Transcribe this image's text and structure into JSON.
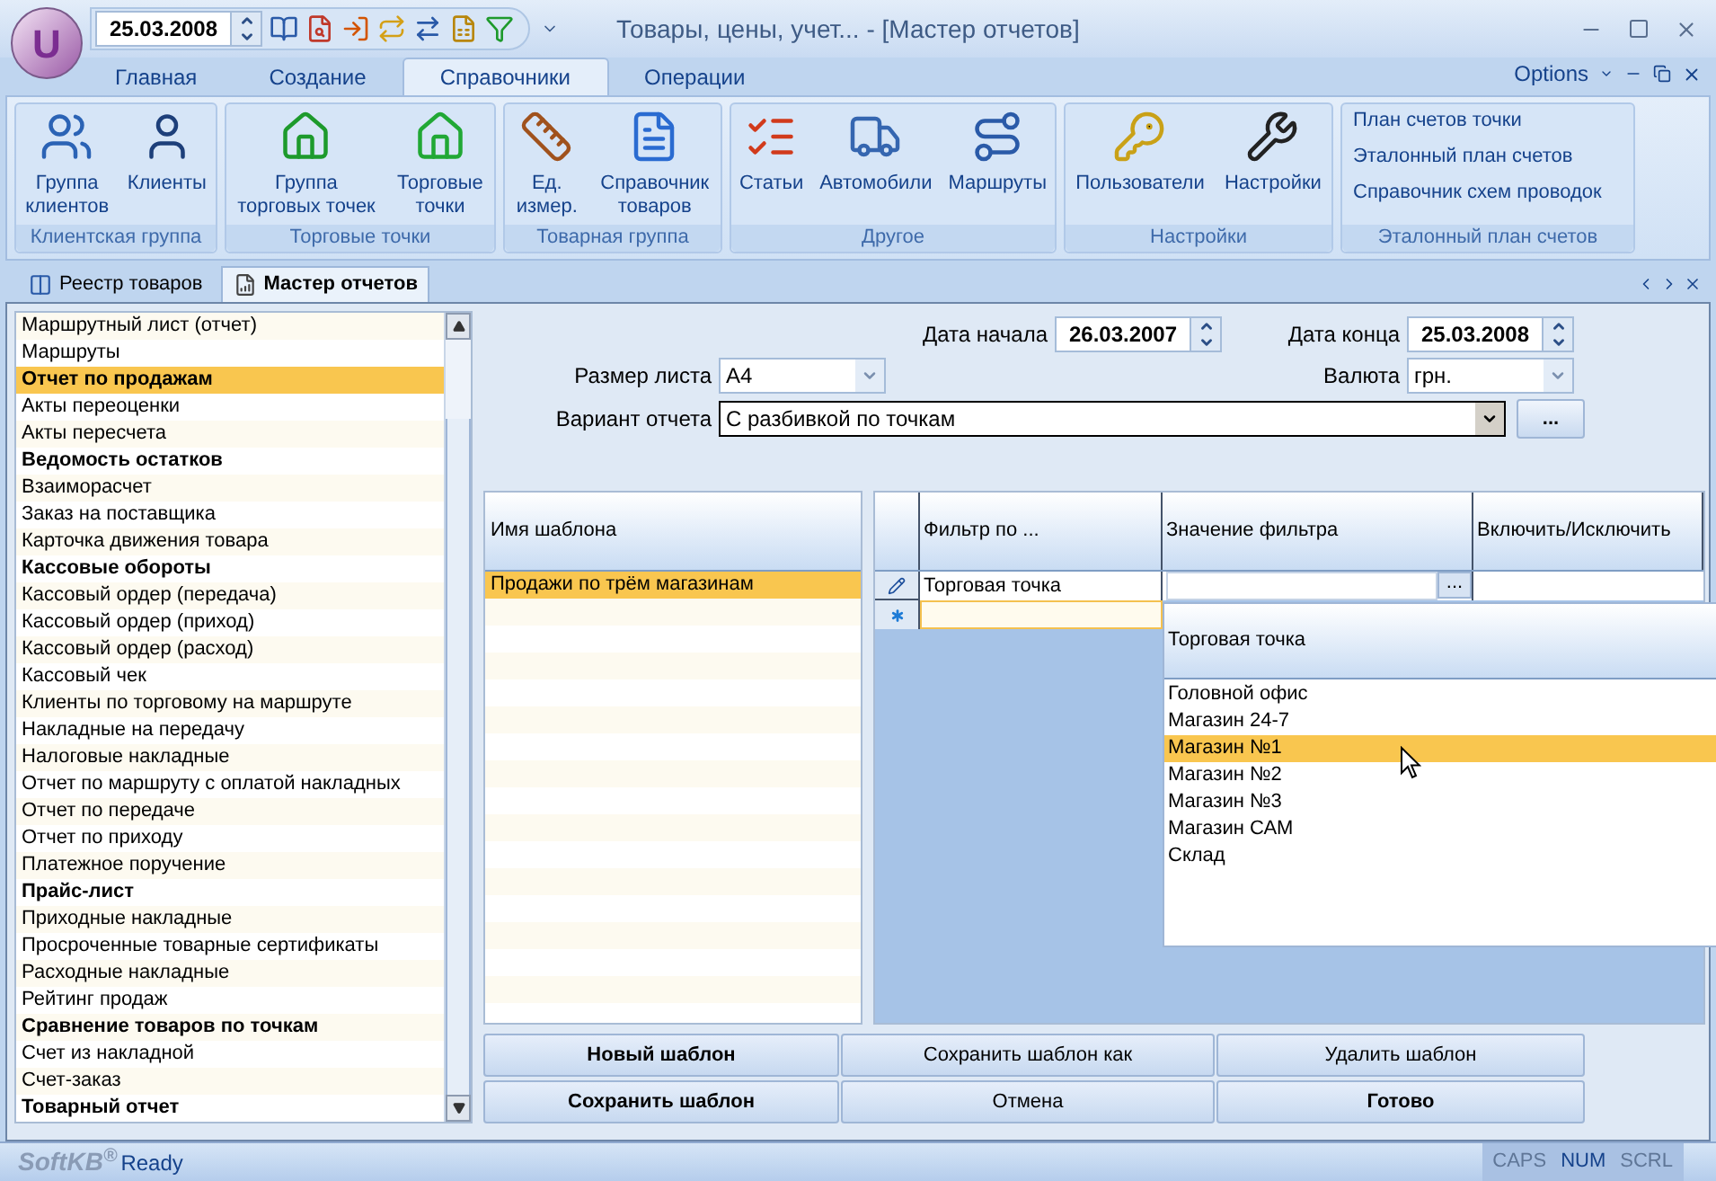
{
  "window": {
    "title": "Товары, цены, учет... - [Мастер отчетов]",
    "app_logo": "U"
  },
  "quick_access": {
    "date": "25.03.2008"
  },
  "ribbon_tabs": [
    {
      "label": "Главная",
      "selected": false
    },
    {
      "label": "Создание",
      "selected": false
    },
    {
      "label": "Справочники",
      "selected": true
    },
    {
      "label": "Операции",
      "selected": false
    }
  ],
  "ribbon_options": "Options",
  "ribbon_groups": [
    {
      "label": "Клиентская группа",
      "kind": "large",
      "buttons": [
        {
          "label": "Группа\nклиентов"
        },
        {
          "label": "Клиенты"
        }
      ]
    },
    {
      "label": "Торговые точки",
      "kind": "large",
      "buttons": [
        {
          "label": "Группа\nторговых точек"
        },
        {
          "label": "Торговые\nточки"
        }
      ]
    },
    {
      "label": "Товарная группа",
      "kind": "large",
      "buttons": [
        {
          "label": "Ед.\nизмер."
        },
        {
          "label": "Справочник\nтоваров"
        }
      ]
    },
    {
      "label": "Другое",
      "kind": "large",
      "buttons": [
        {
          "label": "Статьи"
        },
        {
          "label": "Автомобили"
        },
        {
          "label": "Маршруты"
        }
      ]
    },
    {
      "label": "Настройки",
      "kind": "large",
      "buttons": [
        {
          "label": "Пользователи"
        },
        {
          "label": "Настройки"
        }
      ]
    },
    {
      "label": "Эталонный план счетов",
      "kind": "small",
      "buttons": [
        {
          "label": "План счетов точки"
        },
        {
          "label": "Эталонный план счетов"
        },
        {
          "label": "Справочник схем проводок"
        }
      ]
    }
  ],
  "doc_tabs": [
    {
      "label": "Реестр товаров",
      "selected": false
    },
    {
      "label": "Мастер отчетов",
      "selected": true
    }
  ],
  "report_list": [
    {
      "label": "Маршрутный лист (отчет)",
      "bold": false,
      "selected": false
    },
    {
      "label": "Маршруты",
      "bold": false,
      "selected": false
    },
    {
      "label": "Отчет по продажам",
      "bold": true,
      "selected": true
    },
    {
      "label": "Акты переоценки",
      "bold": false,
      "selected": false
    },
    {
      "label": "Акты пересчета",
      "bold": false,
      "selected": false
    },
    {
      "label": "Ведомость остатков",
      "bold": true,
      "selected": false
    },
    {
      "label": "Взаиморасчет",
      "bold": false,
      "selected": false
    },
    {
      "label": "Заказ на поставщика",
      "bold": false,
      "selected": false
    },
    {
      "label": "Карточка движения товара",
      "bold": false,
      "selected": false
    },
    {
      "label": "Кассовые обороты",
      "bold": true,
      "selected": false
    },
    {
      "label": "Кассовый ордер (передача)",
      "bold": false,
      "selected": false
    },
    {
      "label": "Кассовый ордер (приход)",
      "bold": false,
      "selected": false
    },
    {
      "label": "Кассовый ордер (расход)",
      "bold": false,
      "selected": false
    },
    {
      "label": "Кассовый чек",
      "bold": false,
      "selected": false
    },
    {
      "label": "Клиенты по торговому на маршруте",
      "bold": false,
      "selected": false
    },
    {
      "label": "Накладные на передачу",
      "bold": false,
      "selected": false
    },
    {
      "label": "Налоговые накладные",
      "bold": false,
      "selected": false
    },
    {
      "label": "Отчет по маршруту с оплатой накладных",
      "bold": false,
      "selected": false
    },
    {
      "label": "Отчет по передаче",
      "bold": false,
      "selected": false
    },
    {
      "label": "Отчет по приходу",
      "bold": false,
      "selected": false
    },
    {
      "label": "Платежное поручение",
      "bold": false,
      "selected": false
    },
    {
      "label": "Прайс-лист",
      "bold": true,
      "selected": false
    },
    {
      "label": "Приходные накладные",
      "bold": false,
      "selected": false
    },
    {
      "label": "Просроченные товарные сертификаты",
      "bold": false,
      "selected": false
    },
    {
      "label": "Расходные накладные",
      "bold": false,
      "selected": false
    },
    {
      "label": "Рейтинг продаж",
      "bold": false,
      "selected": false
    },
    {
      "label": "Сравнение товаров по точкам",
      "bold": true,
      "selected": false
    },
    {
      "label": "Счет из накладной",
      "bold": false,
      "selected": false
    },
    {
      "label": "Счет-заказ",
      "bold": false,
      "selected": false
    },
    {
      "label": "Товарный отчет",
      "bold": true,
      "selected": false
    }
  ],
  "form": {
    "start_label": "Дата начала",
    "start_date": "26.03.2007",
    "end_label": "Дата конца",
    "end_date": "25.03.2008",
    "size_label": "Размер листа",
    "size": "A4",
    "currency_label": "Валюта",
    "currency": "грн.",
    "variant_label": "Вариант отчета",
    "variant": "С разбивкой по точкам",
    "variant_button": "..."
  },
  "templates": {
    "column": "Имя шаблона",
    "rows": [
      {
        "name": "Продажи по трём магазинам",
        "selected": true
      }
    ]
  },
  "filters": {
    "columns": [
      "Фильтр по ...",
      "Значение фильтра",
      "Включить/Исключить"
    ],
    "rows": [
      {
        "kind": "edit",
        "filter": "Торговая точка",
        "value_button": "..."
      },
      {
        "kind": "new"
      }
    ]
  },
  "dropdown": {
    "header": "Торговая точка",
    "items": [
      {
        "label": "Головной офис",
        "selected": false
      },
      {
        "label": "Магазин 24-7",
        "selected": false
      },
      {
        "label": "Магазин №1",
        "selected": true
      },
      {
        "label": "Магазин №2",
        "selected": false
      },
      {
        "label": "Магазин №3",
        "selected": false
      },
      {
        "label": "Магазин САМ",
        "selected": false
      },
      {
        "label": "Склад",
        "selected": false
      }
    ]
  },
  "buttons": [
    {
      "label": "Новый шаблон",
      "bold": true
    },
    {
      "label": "Сохранить шаблон как",
      "bold": false
    },
    {
      "label": "Удалить шаблон",
      "bold": false
    },
    {
      "label": "Сохранить шаблон",
      "bold": true
    },
    {
      "label": "Отмена",
      "bold": false
    },
    {
      "label": "Готово",
      "bold": true
    }
  ],
  "status_bar": {
    "logo": "SoftKB$^{®}$",
    "text": "Ready",
    "indicators": [
      {
        "label": "CAPS",
        "on": false
      },
      {
        "label": "NUM",
        "on": true
      },
      {
        "label": "SCRL",
        "on": false
      }
    ]
  }
}
